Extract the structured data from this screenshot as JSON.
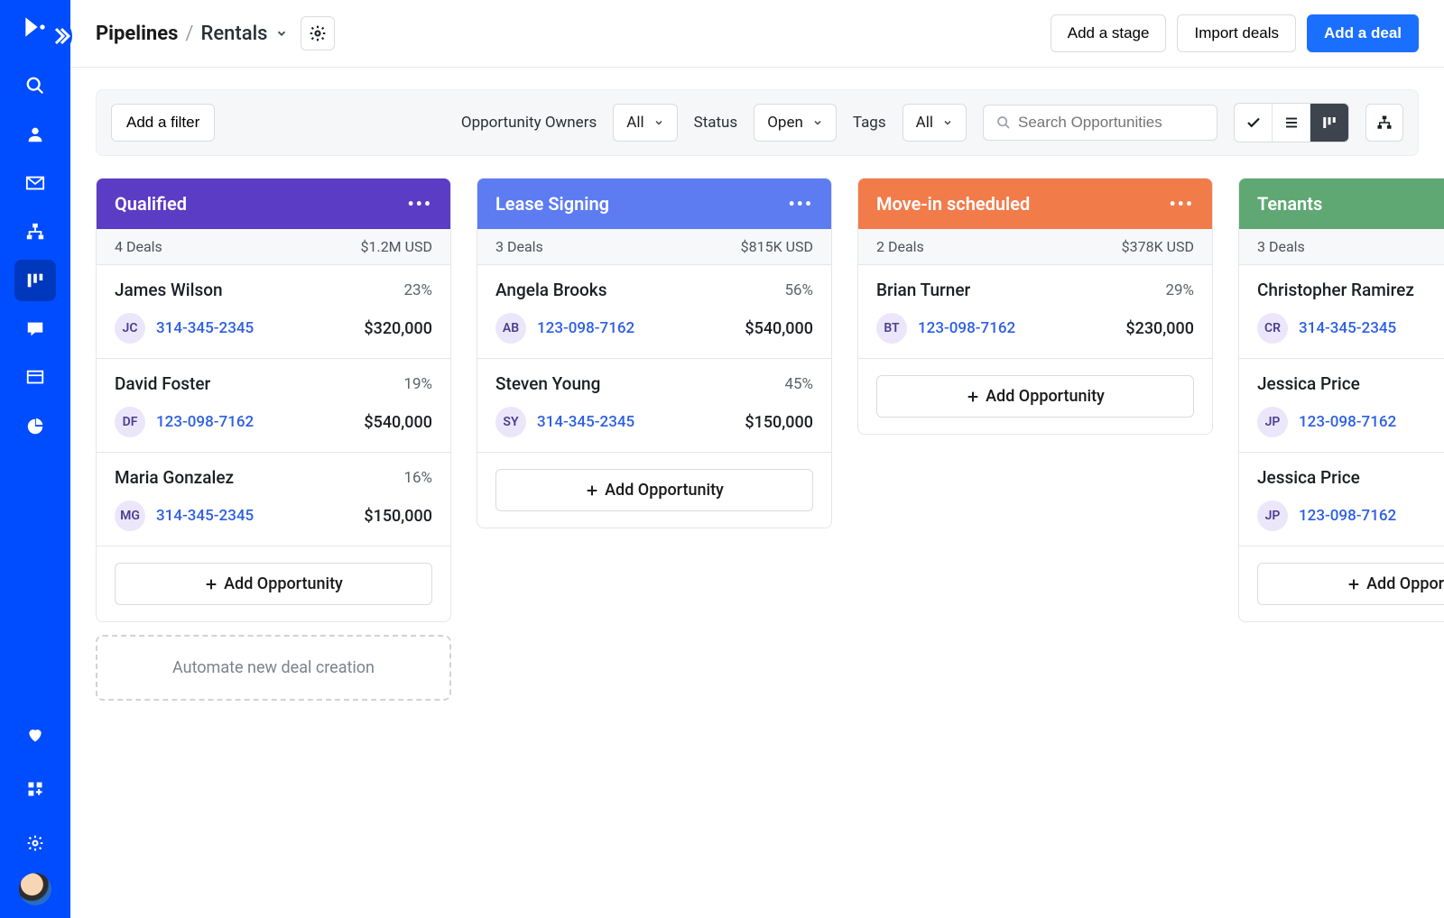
{
  "topbar": {
    "breadcrumb_root": "Pipelines",
    "breadcrumb_sep": "/",
    "pipeline_name": "Rentals",
    "add_stage": "Add a stage",
    "import_deals": "Import deals",
    "add_deal": "Add a deal"
  },
  "filters": {
    "add_filter": "Add a filter",
    "owners_label": "Opportunity Owners",
    "owners_value": "All",
    "status_label": "Status",
    "status_value": "Open",
    "tags_label": "Tags",
    "tags_value": "All",
    "search_placeholder": "Search Opportunities"
  },
  "columns": [
    {
      "name": "Qualified",
      "color": "#5b3cc4",
      "deals_count": "4 Deals",
      "total": "$1.2M USD",
      "cards": [
        {
          "name": "James Wilson",
          "pct": "23%",
          "initials": "JC",
          "phone": "314-345-2345",
          "amount": "$320,000"
        },
        {
          "name": "David Foster",
          "pct": "19%",
          "initials": "DF",
          "phone": "123-098-7162",
          "amount": "$540,000"
        },
        {
          "name": "Maria Gonzalez",
          "pct": "16%",
          "initials": "MG",
          "phone": "314-345-2345",
          "amount": "$150,000"
        }
      ],
      "add_label": "Add Opportunity",
      "automate": "Automate new deal creation"
    },
    {
      "name": "Lease Signing",
      "color": "#5d7cf2",
      "deals_count": "3 Deals",
      "total": "$815K USD",
      "cards": [
        {
          "name": "Angela Brooks",
          "pct": "56%",
          "initials": "AB",
          "phone": "123-098-7162",
          "amount": "$540,000"
        },
        {
          "name": "Steven Young",
          "pct": "45%",
          "initials": "SY",
          "phone": "314-345-2345",
          "amount": "$150,000"
        }
      ],
      "add_label": "Add Opportunity"
    },
    {
      "name": "Move-in scheduled",
      "color": "#f27b4a",
      "deals_count": "2 Deals",
      "total": "$378K USD",
      "cards": [
        {
          "name": "Brian Turner",
          "pct": "29%",
          "initials": "BT",
          "phone": "123-098-7162",
          "amount": "$230,000"
        }
      ],
      "add_label": "Add Opportunity"
    },
    {
      "name": "Tenants",
      "color": "#5fa874",
      "deals_count": "3 Deals",
      "total": "",
      "cards": [
        {
          "name": "Christopher Ramirez",
          "pct": "",
          "initials": "CR",
          "phone": "314-345-2345",
          "amount": ""
        },
        {
          "name": "Jessica Price",
          "pct": "",
          "initials": "JP",
          "phone": "123-098-7162",
          "amount": ""
        },
        {
          "name": "Jessica Price",
          "pct": "",
          "initials": "JP",
          "phone": "123-098-7162",
          "amount": ""
        }
      ],
      "add_label": "Add Opportunity"
    }
  ]
}
